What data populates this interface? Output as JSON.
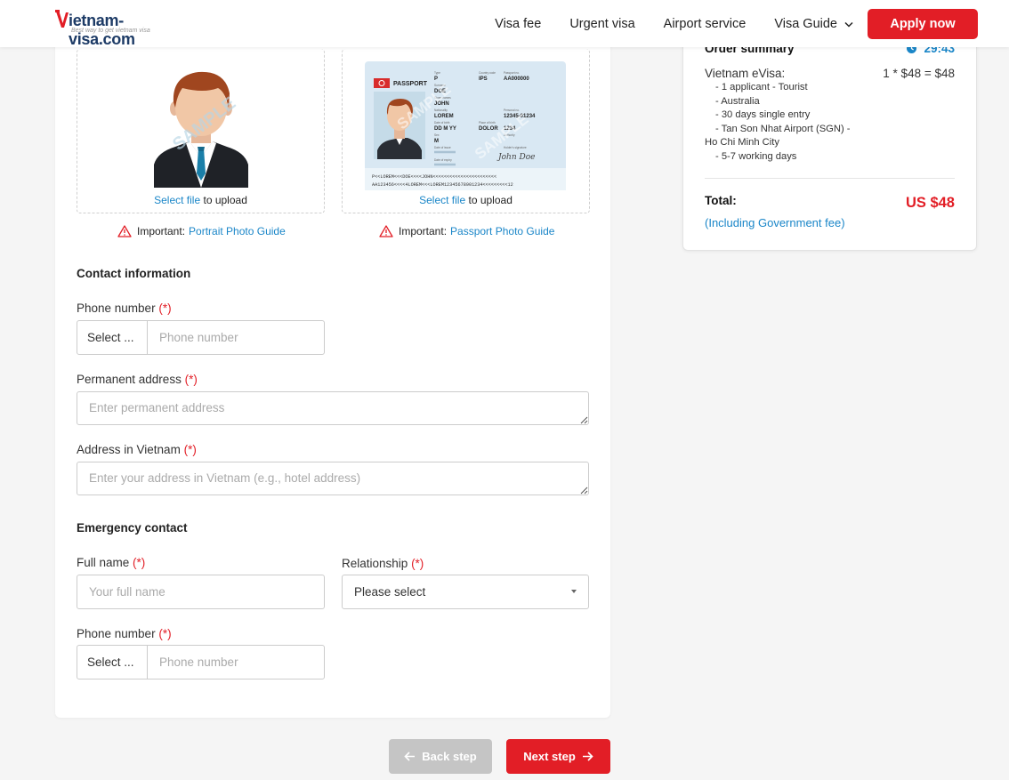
{
  "header": {
    "logo_text": "ietnam-visa.com",
    "logo_tagline": "Best way to get vietnam visa",
    "nav": [
      "Visa fee",
      "Urgent visa",
      "Airport service",
      "Visa Guide"
    ],
    "apply_label": "Apply now"
  },
  "uploads": {
    "portrait": {
      "link": "Select file",
      "suffix": " to upload",
      "important_label": "Important:",
      "guide_link": "Portrait Photo Guide",
      "watermark": "SAMPLE"
    },
    "passport": {
      "link": "Select file",
      "suffix": " to upload",
      "important_label": "Important:",
      "guide_link": "Passport Photo Guide",
      "watermark": "SAMPLE",
      "card_title": "PASSPORT",
      "type": "P",
      "country": "IPS",
      "number": "AA000000",
      "surname": "DOE",
      "given": "JOHN",
      "nationality": "LOREM",
      "dob": "DD M YY",
      "pob": "DOLOR",
      "sex": "M",
      "personal_no": "12345-01234",
      "auth": "1234",
      "signature": "John Doe",
      "mrz1": "P<<LOREM<<<DOE<<<<JOHN<<<<<<<<<<<<<<<<<<<<<<<",
      "mrz2": "AA123456<<<<4LOREM<<<LOREM12345678901234<<<<<<<<<12"
    }
  },
  "contact": {
    "title": "Contact information",
    "phone_label": "Phone number",
    "req": "(*)",
    "phone_select": "Select ...",
    "phone_placeholder": "Phone number",
    "perm_label": "Permanent address",
    "perm_placeholder": "Enter permanent address",
    "vn_label": "Address in Vietnam",
    "vn_placeholder": "Enter your address in Vietnam (e.g., hotel address)"
  },
  "emergency": {
    "title": "Emergency contact",
    "name_label": "Full name",
    "name_placeholder": "Your full name",
    "rel_label": "Relationship",
    "rel_value": "Please select",
    "phone_label": "Phone number",
    "phone_select": "Select ...",
    "phone_placeholder": "Phone number"
  },
  "buttons": {
    "back": "Back step",
    "next": "Next step"
  },
  "summary": {
    "title": "Order summary",
    "timer": "29:43",
    "item": "Vietnam eVisa:",
    "price": "1 * $48 = $48",
    "details": [
      "- 1 applicant - Tourist",
      "- Australia",
      "- 30 days single entry",
      "- Tan Son Nhat Airport (SGN) -",
      "Ho Chi Minh City",
      "- 5-7 working days"
    ],
    "total_label": "Total:",
    "total_note": "(Including Government fee)",
    "total_value": "US $48"
  },
  "colors": {
    "brand_red": "#e21e26",
    "link_blue": "#1a86c8",
    "navy": "#1d3b66"
  }
}
